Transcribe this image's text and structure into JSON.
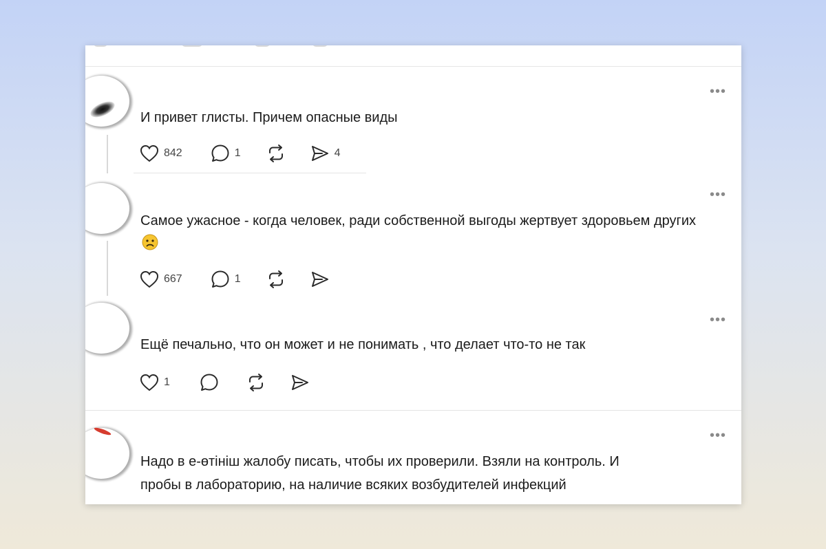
{
  "comments": [
    {
      "text": "И привет глисты. Причем опасные виды",
      "likes": "842",
      "replies": "1",
      "shares": "4",
      "more_icon": "more-dots-icon"
    },
    {
      "text": "Самое ужасное - когда человек, ради собственной выгоды жертвует здоровьем других",
      "emoji": "sad-face-emoji",
      "likes": "667",
      "replies": "1",
      "more_icon": "more-dots-icon"
    },
    {
      "text": "Ещё печально, что он может и не понимать , что делает что-то не так",
      "likes": "1",
      "more_icon": "more-dots-icon"
    },
    {
      "text_line1": "Надо в е-өтініш жалобу писать, чтобы их проверили. Взяли на контроль. И",
      "text_line2": "пробы в лабораторию, на наличие всяких возбудителей инфекций",
      "more_icon": "more-dots-icon"
    }
  ],
  "icons": {
    "like": "heart-icon",
    "reply": "comment-bubble-icon",
    "repost": "repost-icon",
    "share": "send-icon"
  },
  "colors": {
    "page_bg_top": "#c3d3f6",
    "page_bg_bottom": "#efe9d9",
    "text": "#1b1b1b",
    "muted": "#8a8a8a"
  }
}
